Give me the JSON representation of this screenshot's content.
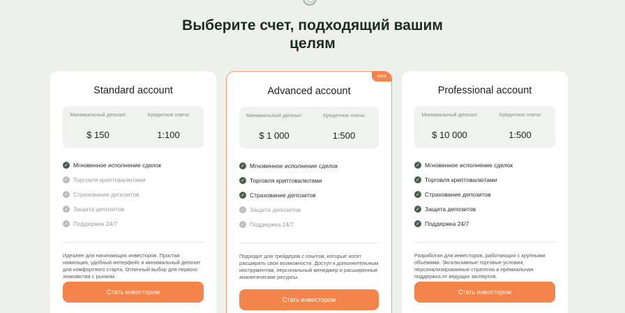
{
  "title_line1": "Выберите счет, подходящий вашим",
  "title_line2": "целям",
  "cards": [
    {
      "name": "Standard account",
      "deposit_label": "Минимальный депозит",
      "deposit": "$ 150",
      "leverage_label": "Кредитное плечо",
      "leverage": "1:100",
      "features": [
        {
          "text": "Мгновенное исполнение сделок",
          "enabled": true
        },
        {
          "text": "Торговля криптовалютами",
          "enabled": false
        },
        {
          "text": "Страхование депозитов",
          "enabled": false
        },
        {
          "text": "Защита депозитов",
          "enabled": false
        },
        {
          "text": "Поддержка 24/7",
          "enabled": false
        }
      ],
      "description": "Идеален для начинающих инвесторов. Простая навигация, удобный интерфейс и минимальный депозит для комфортного старта. Отличный выбор для первого знакомства с рынком.",
      "button": "Стать инвестором"
    },
    {
      "name": "Advanced account",
      "badge": "best",
      "deposit_label": "Минимальный депозит",
      "deposit": "$ 1 000",
      "leverage_label": "Кредитное плечо",
      "leverage": "1:500",
      "features": [
        {
          "text": "Мгновенное исполнение сделок",
          "enabled": true
        },
        {
          "text": "Торговля криптовалютами",
          "enabled": true
        },
        {
          "text": "Страхование депозитов",
          "enabled": true
        },
        {
          "text": "Защита депозитов",
          "enabled": false
        },
        {
          "text": "Поддержка 24/7",
          "enabled": false
        }
      ],
      "description": "Подходит для трейдеров с опытом, которые хотят расширить свои возможности. Доступ к дополнительным инструментам, персональный менеджер и расширенные аналитические ресурсы.",
      "button": "Стать инвестором"
    },
    {
      "name": "Professional account",
      "deposit_label": "Минимальный депозит",
      "deposit": "$ 10 000",
      "leverage_label": "Кредитное плечо",
      "leverage": "1:500",
      "features": [
        {
          "text": "Мгновенное исполнение сделок",
          "enabled": true
        },
        {
          "text": "Торговля криптовалютами",
          "enabled": true
        },
        {
          "text": "Страхование депозитов",
          "enabled": true
        },
        {
          "text": "Защита депозитов",
          "enabled": true
        },
        {
          "text": "Поддержка 24/7",
          "enabled": true
        }
      ],
      "description": "Разработан для инвесторов, работающих с крупными объемами. Эксклюзивные торговые условия, персонализированные стратегии и премиальная поддержка от ведущих экспертов.",
      "button": "Стать инвестором"
    }
  ],
  "check_icon": "check-circle-icon",
  "colors": {
    "accent": "#f4844a",
    "check_on": "#4a5e4c",
    "check_off": "#b9bcb8",
    "background": "#eef0ec"
  }
}
